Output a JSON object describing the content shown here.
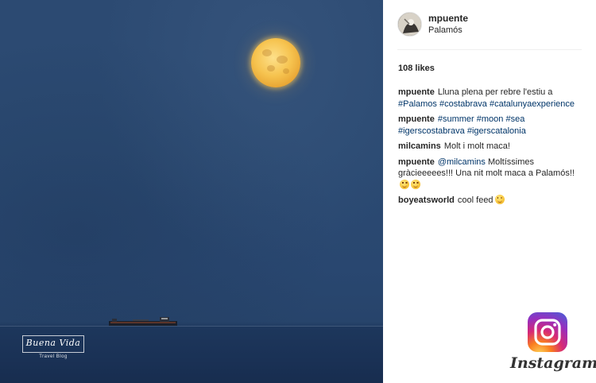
{
  "post": {
    "username": "mpuente",
    "location": "Palamós",
    "likes": "108 likes"
  },
  "comments": [
    {
      "author": "mpuente",
      "parts": [
        {
          "text": "Lluna plena per rebre l'estiu a ",
          "tag": false
        },
        {
          "text": "#Palamos",
          "tag": true
        },
        {
          "text": " ",
          "tag": false
        },
        {
          "text": "#costabrava",
          "tag": true
        },
        {
          "text": " ",
          "tag": false
        },
        {
          "text": "#catalunyaexperience",
          "tag": true
        }
      ],
      "emoji_count": 0
    },
    {
      "author": "mpuente",
      "parts": [
        {
          "text": "#summer",
          "tag": true
        },
        {
          "text": " ",
          "tag": false
        },
        {
          "text": "#moon",
          "tag": true
        },
        {
          "text": " ",
          "tag": false
        },
        {
          "text": "#sea",
          "tag": true
        },
        {
          "text": " ",
          "tag": false
        },
        {
          "text": "#igerscostabrava",
          "tag": true
        },
        {
          "text": " ",
          "tag": false
        },
        {
          "text": "#igerscatalonia",
          "tag": true
        }
      ],
      "emoji_count": 0
    },
    {
      "author": "milcamins",
      "parts": [
        {
          "text": "Molt i molt maca!",
          "tag": false
        }
      ],
      "emoji_count": 0
    },
    {
      "author": "mpuente",
      "parts": [
        {
          "text": "@milcamins",
          "tag": true
        },
        {
          "text": " Moltíssimes gràcieeeees!!! Una nit molt maca a Palamós!!",
          "tag": false
        }
      ],
      "emoji_count": 2
    },
    {
      "author": "boyeatsworld",
      "parts": [
        {
          "text": "cool feed",
          "tag": false
        }
      ],
      "emoji_count": 1
    }
  ],
  "watermark": {
    "title": "Buena Vida",
    "subtitle": "Travel Blog"
  },
  "brand": {
    "wordmark": "Instagram",
    "logo_icon": "instagram-camera-icon"
  },
  "colors": {
    "hashtag": "#003569",
    "text": "#262626"
  }
}
